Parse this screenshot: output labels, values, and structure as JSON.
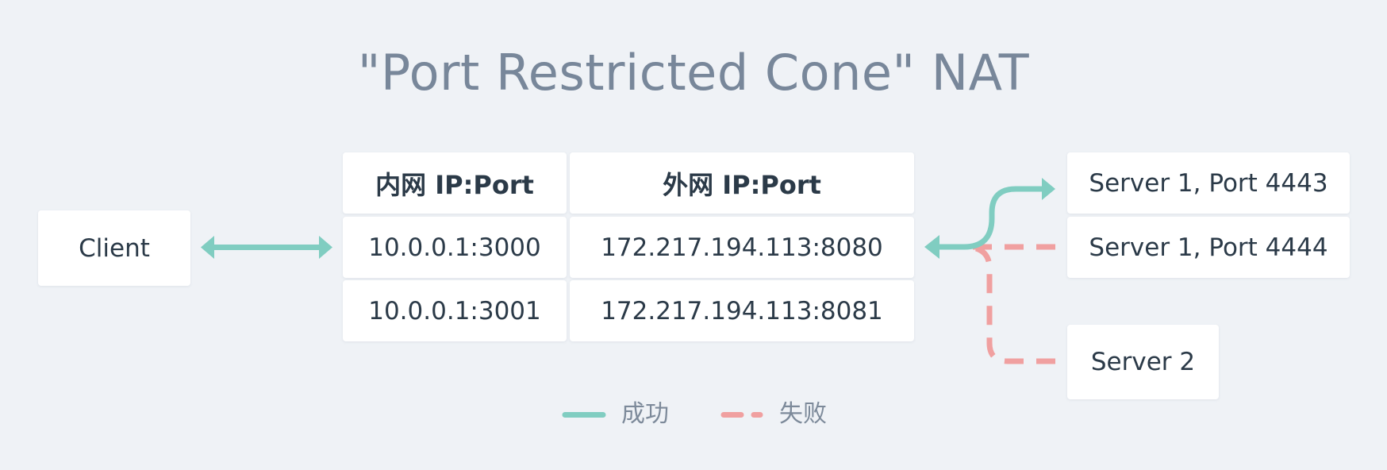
{
  "title": "\"Port Restricted Cone\" NAT",
  "client": {
    "label": "Client"
  },
  "table": {
    "headers": [
      "内网 IP:Port",
      "外网 IP:Port"
    ],
    "rows": [
      [
        "10.0.0.1:3000",
        "172.217.194.113:8080"
      ],
      [
        "10.0.0.1:3001",
        "172.217.194.113:8081"
      ]
    ]
  },
  "servers": [
    {
      "label": "Server 1, Port 4443"
    },
    {
      "label": "Server 1, Port 4444"
    },
    {
      "label": "Server 2"
    }
  ],
  "legend": {
    "success": "成功",
    "failure": "失败"
  },
  "colors": {
    "background": "#eff2f6",
    "success": "#80cdc1",
    "failure": "#f0a0a0",
    "title": "#78879a",
    "text": "#2b3a48"
  }
}
